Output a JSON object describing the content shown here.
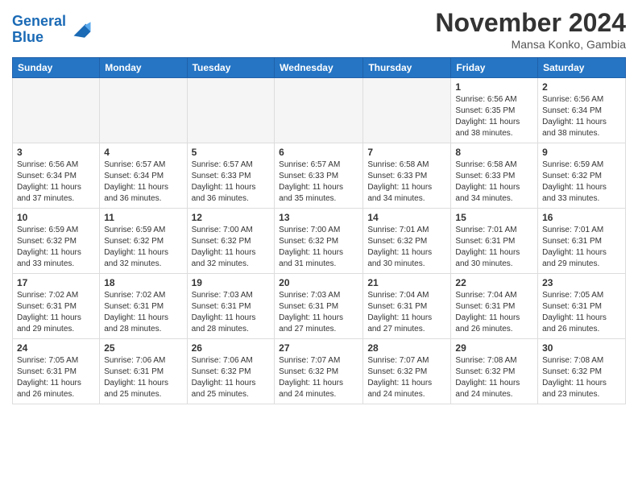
{
  "header": {
    "logo_line1": "General",
    "logo_line2": "Blue",
    "month": "November 2024",
    "location": "Mansa Konko, Gambia"
  },
  "weekdays": [
    "Sunday",
    "Monday",
    "Tuesday",
    "Wednesday",
    "Thursday",
    "Friday",
    "Saturday"
  ],
  "weeks": [
    [
      {
        "day": "",
        "info": ""
      },
      {
        "day": "",
        "info": ""
      },
      {
        "day": "",
        "info": ""
      },
      {
        "day": "",
        "info": ""
      },
      {
        "day": "",
        "info": ""
      },
      {
        "day": "1",
        "info": "Sunrise: 6:56 AM\nSunset: 6:35 PM\nDaylight: 11 hours\nand 38 minutes."
      },
      {
        "day": "2",
        "info": "Sunrise: 6:56 AM\nSunset: 6:34 PM\nDaylight: 11 hours\nand 38 minutes."
      }
    ],
    [
      {
        "day": "3",
        "info": "Sunrise: 6:56 AM\nSunset: 6:34 PM\nDaylight: 11 hours\nand 37 minutes."
      },
      {
        "day": "4",
        "info": "Sunrise: 6:57 AM\nSunset: 6:34 PM\nDaylight: 11 hours\nand 36 minutes."
      },
      {
        "day": "5",
        "info": "Sunrise: 6:57 AM\nSunset: 6:33 PM\nDaylight: 11 hours\nand 36 minutes."
      },
      {
        "day": "6",
        "info": "Sunrise: 6:57 AM\nSunset: 6:33 PM\nDaylight: 11 hours\nand 35 minutes."
      },
      {
        "day": "7",
        "info": "Sunrise: 6:58 AM\nSunset: 6:33 PM\nDaylight: 11 hours\nand 34 minutes."
      },
      {
        "day": "8",
        "info": "Sunrise: 6:58 AM\nSunset: 6:33 PM\nDaylight: 11 hours\nand 34 minutes."
      },
      {
        "day": "9",
        "info": "Sunrise: 6:59 AM\nSunset: 6:32 PM\nDaylight: 11 hours\nand 33 minutes."
      }
    ],
    [
      {
        "day": "10",
        "info": "Sunrise: 6:59 AM\nSunset: 6:32 PM\nDaylight: 11 hours\nand 33 minutes."
      },
      {
        "day": "11",
        "info": "Sunrise: 6:59 AM\nSunset: 6:32 PM\nDaylight: 11 hours\nand 32 minutes."
      },
      {
        "day": "12",
        "info": "Sunrise: 7:00 AM\nSunset: 6:32 PM\nDaylight: 11 hours\nand 32 minutes."
      },
      {
        "day": "13",
        "info": "Sunrise: 7:00 AM\nSunset: 6:32 PM\nDaylight: 11 hours\nand 31 minutes."
      },
      {
        "day": "14",
        "info": "Sunrise: 7:01 AM\nSunset: 6:32 PM\nDaylight: 11 hours\nand 30 minutes."
      },
      {
        "day": "15",
        "info": "Sunrise: 7:01 AM\nSunset: 6:31 PM\nDaylight: 11 hours\nand 30 minutes."
      },
      {
        "day": "16",
        "info": "Sunrise: 7:01 AM\nSunset: 6:31 PM\nDaylight: 11 hours\nand 29 minutes."
      }
    ],
    [
      {
        "day": "17",
        "info": "Sunrise: 7:02 AM\nSunset: 6:31 PM\nDaylight: 11 hours\nand 29 minutes."
      },
      {
        "day": "18",
        "info": "Sunrise: 7:02 AM\nSunset: 6:31 PM\nDaylight: 11 hours\nand 28 minutes."
      },
      {
        "day": "19",
        "info": "Sunrise: 7:03 AM\nSunset: 6:31 PM\nDaylight: 11 hours\nand 28 minutes."
      },
      {
        "day": "20",
        "info": "Sunrise: 7:03 AM\nSunset: 6:31 PM\nDaylight: 11 hours\nand 27 minutes."
      },
      {
        "day": "21",
        "info": "Sunrise: 7:04 AM\nSunset: 6:31 PM\nDaylight: 11 hours\nand 27 minutes."
      },
      {
        "day": "22",
        "info": "Sunrise: 7:04 AM\nSunset: 6:31 PM\nDaylight: 11 hours\nand 26 minutes."
      },
      {
        "day": "23",
        "info": "Sunrise: 7:05 AM\nSunset: 6:31 PM\nDaylight: 11 hours\nand 26 minutes."
      }
    ],
    [
      {
        "day": "24",
        "info": "Sunrise: 7:05 AM\nSunset: 6:31 PM\nDaylight: 11 hours\nand 26 minutes."
      },
      {
        "day": "25",
        "info": "Sunrise: 7:06 AM\nSunset: 6:31 PM\nDaylight: 11 hours\nand 25 minutes."
      },
      {
        "day": "26",
        "info": "Sunrise: 7:06 AM\nSunset: 6:32 PM\nDaylight: 11 hours\nand 25 minutes."
      },
      {
        "day": "27",
        "info": "Sunrise: 7:07 AM\nSunset: 6:32 PM\nDaylight: 11 hours\nand 24 minutes."
      },
      {
        "day": "28",
        "info": "Sunrise: 7:07 AM\nSunset: 6:32 PM\nDaylight: 11 hours\nand 24 minutes."
      },
      {
        "day": "29",
        "info": "Sunrise: 7:08 AM\nSunset: 6:32 PM\nDaylight: 11 hours\nand 24 minutes."
      },
      {
        "day": "30",
        "info": "Sunrise: 7:08 AM\nSunset: 6:32 PM\nDaylight: 11 hours\nand 23 minutes."
      }
    ]
  ]
}
